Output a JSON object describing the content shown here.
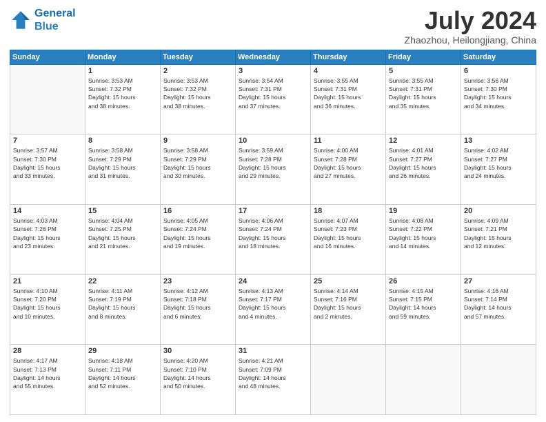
{
  "header": {
    "logo_line1": "General",
    "logo_line2": "Blue",
    "month": "July 2024",
    "location": "Zhaozhou, Heilongjiang, China"
  },
  "weekdays": [
    "Sunday",
    "Monday",
    "Tuesday",
    "Wednesday",
    "Thursday",
    "Friday",
    "Saturday"
  ],
  "weeks": [
    [
      {
        "day": "",
        "info": ""
      },
      {
        "day": "1",
        "info": "Sunrise: 3:53 AM\nSunset: 7:32 PM\nDaylight: 15 hours\nand 38 minutes."
      },
      {
        "day": "2",
        "info": "Sunrise: 3:53 AM\nSunset: 7:32 PM\nDaylight: 15 hours\nand 38 minutes."
      },
      {
        "day": "3",
        "info": "Sunrise: 3:54 AM\nSunset: 7:31 PM\nDaylight: 15 hours\nand 37 minutes."
      },
      {
        "day": "4",
        "info": "Sunrise: 3:55 AM\nSunset: 7:31 PM\nDaylight: 15 hours\nand 36 minutes."
      },
      {
        "day": "5",
        "info": "Sunrise: 3:55 AM\nSunset: 7:31 PM\nDaylight: 15 hours\nand 35 minutes."
      },
      {
        "day": "6",
        "info": "Sunrise: 3:56 AM\nSunset: 7:30 PM\nDaylight: 15 hours\nand 34 minutes."
      }
    ],
    [
      {
        "day": "7",
        "info": "Sunrise: 3:57 AM\nSunset: 7:30 PM\nDaylight: 15 hours\nand 33 minutes."
      },
      {
        "day": "8",
        "info": "Sunrise: 3:58 AM\nSunset: 7:29 PM\nDaylight: 15 hours\nand 31 minutes."
      },
      {
        "day": "9",
        "info": "Sunrise: 3:58 AM\nSunset: 7:29 PM\nDaylight: 15 hours\nand 30 minutes."
      },
      {
        "day": "10",
        "info": "Sunrise: 3:59 AM\nSunset: 7:28 PM\nDaylight: 15 hours\nand 29 minutes."
      },
      {
        "day": "11",
        "info": "Sunrise: 4:00 AM\nSunset: 7:28 PM\nDaylight: 15 hours\nand 27 minutes."
      },
      {
        "day": "12",
        "info": "Sunrise: 4:01 AM\nSunset: 7:27 PM\nDaylight: 15 hours\nand 26 minutes."
      },
      {
        "day": "13",
        "info": "Sunrise: 4:02 AM\nSunset: 7:27 PM\nDaylight: 15 hours\nand 24 minutes."
      }
    ],
    [
      {
        "day": "14",
        "info": "Sunrise: 4:03 AM\nSunset: 7:26 PM\nDaylight: 15 hours\nand 23 minutes."
      },
      {
        "day": "15",
        "info": "Sunrise: 4:04 AM\nSunset: 7:25 PM\nDaylight: 15 hours\nand 21 minutes."
      },
      {
        "day": "16",
        "info": "Sunrise: 4:05 AM\nSunset: 7:24 PM\nDaylight: 15 hours\nand 19 minutes."
      },
      {
        "day": "17",
        "info": "Sunrise: 4:06 AM\nSunset: 7:24 PM\nDaylight: 15 hours\nand 18 minutes."
      },
      {
        "day": "18",
        "info": "Sunrise: 4:07 AM\nSunset: 7:23 PM\nDaylight: 15 hours\nand 16 minutes."
      },
      {
        "day": "19",
        "info": "Sunrise: 4:08 AM\nSunset: 7:22 PM\nDaylight: 15 hours\nand 14 minutes."
      },
      {
        "day": "20",
        "info": "Sunrise: 4:09 AM\nSunset: 7:21 PM\nDaylight: 15 hours\nand 12 minutes."
      }
    ],
    [
      {
        "day": "21",
        "info": "Sunrise: 4:10 AM\nSunset: 7:20 PM\nDaylight: 15 hours\nand 10 minutes."
      },
      {
        "day": "22",
        "info": "Sunrise: 4:11 AM\nSunset: 7:19 PM\nDaylight: 15 hours\nand 8 minutes."
      },
      {
        "day": "23",
        "info": "Sunrise: 4:12 AM\nSunset: 7:18 PM\nDaylight: 15 hours\nand 6 minutes."
      },
      {
        "day": "24",
        "info": "Sunrise: 4:13 AM\nSunset: 7:17 PM\nDaylight: 15 hours\nand 4 minutes."
      },
      {
        "day": "25",
        "info": "Sunrise: 4:14 AM\nSunset: 7:16 PM\nDaylight: 15 hours\nand 2 minutes."
      },
      {
        "day": "26",
        "info": "Sunrise: 4:15 AM\nSunset: 7:15 PM\nDaylight: 14 hours\nand 59 minutes."
      },
      {
        "day": "27",
        "info": "Sunrise: 4:16 AM\nSunset: 7:14 PM\nDaylight: 14 hours\nand 57 minutes."
      }
    ],
    [
      {
        "day": "28",
        "info": "Sunrise: 4:17 AM\nSunset: 7:13 PM\nDaylight: 14 hours\nand 55 minutes."
      },
      {
        "day": "29",
        "info": "Sunrise: 4:18 AM\nSunset: 7:11 PM\nDaylight: 14 hours\nand 52 minutes."
      },
      {
        "day": "30",
        "info": "Sunrise: 4:20 AM\nSunset: 7:10 PM\nDaylight: 14 hours\nand 50 minutes."
      },
      {
        "day": "31",
        "info": "Sunrise: 4:21 AM\nSunset: 7:09 PM\nDaylight: 14 hours\nand 48 minutes."
      },
      {
        "day": "",
        "info": ""
      },
      {
        "day": "",
        "info": ""
      },
      {
        "day": "",
        "info": ""
      }
    ]
  ]
}
